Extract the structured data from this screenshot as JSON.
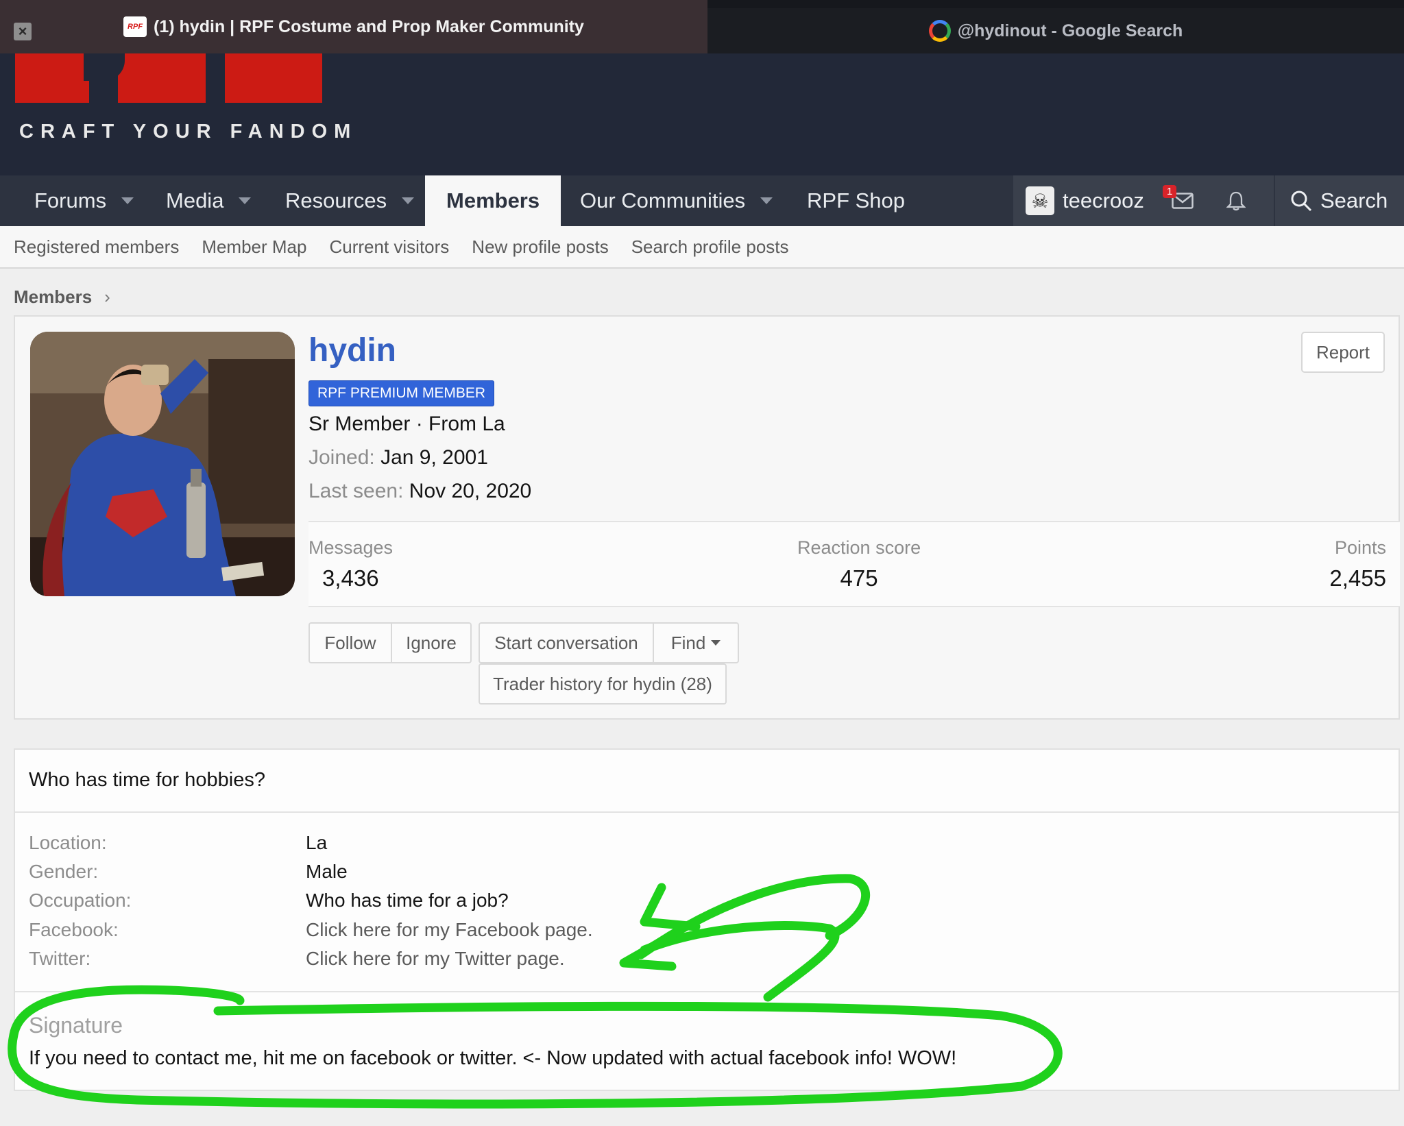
{
  "browser": {
    "tabs": [
      {
        "title": "(1) hydin | RPF Costume and Prop Maker Community",
        "active": true
      },
      {
        "title": "@hydinout - Google Search",
        "active": false
      }
    ]
  },
  "site": {
    "logo_text": "RPF",
    "tagline": "CRAFT YOUR FANDOM",
    "brand_color": "#cc1b14"
  },
  "nav": {
    "items": [
      {
        "label": "Forums",
        "has_dropdown": true
      },
      {
        "label": "Media",
        "has_dropdown": true
      },
      {
        "label": "Resources",
        "has_dropdown": true
      },
      {
        "label": "Members",
        "selected": true
      },
      {
        "label": "Our Communities",
        "has_dropdown": true
      },
      {
        "label": "RPF Shop"
      }
    ],
    "username": "teecrooz",
    "message_badge": "1",
    "search_label": "Search"
  },
  "subnav": {
    "links": [
      "Registered members",
      "Member Map",
      "Current visitors",
      "New profile posts",
      "Search profile posts"
    ]
  },
  "breadcrumb": {
    "label": "Members"
  },
  "profile": {
    "name": "hydin",
    "badge": "RPF PREMIUM MEMBER",
    "title_line": "Sr Member · From La",
    "joined_label": "Joined:",
    "joined_value": "Jan 9, 2001",
    "last_seen_label": "Last seen:",
    "last_seen_value": "Nov 20, 2020",
    "report_label": "Report",
    "stats": {
      "messages_label": "Messages",
      "messages_value": "3,436",
      "reaction_label": "Reaction score",
      "reaction_value": "475",
      "points_label": "Points",
      "points_value": "2,455"
    },
    "buttons": {
      "follow": "Follow",
      "ignore": "Ignore",
      "start_conversation": "Start conversation",
      "find": "Find",
      "trader_history": "Trader history for hydin (28)"
    }
  },
  "about": {
    "title": "Who has time for hobbies?",
    "fields": {
      "location_label": "Location:",
      "location_value": "La",
      "gender_label": "Gender:",
      "gender_value": "Male",
      "occupation_label": "Occupation:",
      "occupation_value": "Who has time for a job?",
      "facebook_label": "Facebook:",
      "facebook_value": "Click here for my Facebook page.",
      "twitter_label": "Twitter:",
      "twitter_value": "Click here for my Twitter page."
    },
    "signature_heading": "Signature",
    "signature_text": "If you need to contact me, hit me on facebook or twitter. <- Now updated with actual facebook info! WOW!"
  },
  "annotation": {
    "color": "#1fd11c"
  }
}
